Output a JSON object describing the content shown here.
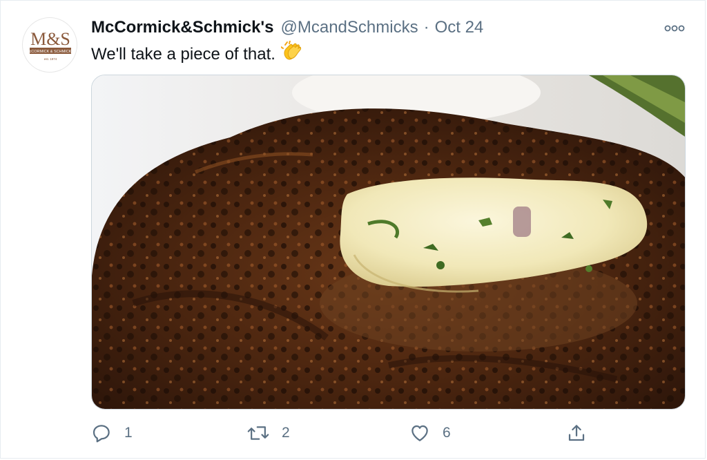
{
  "tweet": {
    "author": {
      "display_name": "McCormick&Schmick's",
      "handle": "@McandSchmicks",
      "avatar_logo_text": "M&S",
      "avatar_sub_text": "McCORMICK & SCHMICK'S",
      "avatar_est_text": "est. 1974"
    },
    "separator": "·",
    "date": "Oct 24",
    "text": "We'll take a piece of that.",
    "emoji": "clapping-hands",
    "media": {
      "description_icon": "steak-photo"
    },
    "actions": {
      "reply_count": "1",
      "retweet_count": "2",
      "like_count": "6"
    }
  },
  "colors": {
    "text_primary": "#0f1419",
    "text_secondary": "#5b7083",
    "border": "#e6ecf0",
    "logo_brown": "#8b5a3c"
  }
}
